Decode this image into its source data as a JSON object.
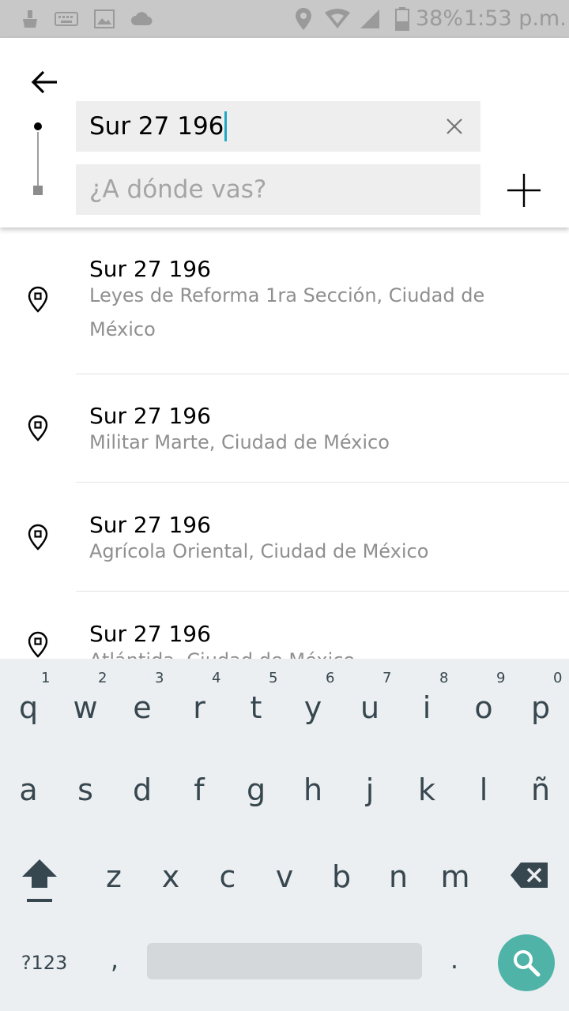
{
  "status_bar": {
    "battery": "38%",
    "time": "1:53 p.m."
  },
  "search": {
    "origin_value": "Sur 27 196",
    "destination_placeholder": "¿A dónde vas?"
  },
  "results": [
    {
      "title": "Sur 27 196",
      "subtitle": "Leyes de Reforma 1ra Sección, Ciudad de México"
    },
    {
      "title": "Sur 27 196",
      "subtitle": "Militar Marte, Ciudad de México"
    },
    {
      "title": "Sur 27 196",
      "subtitle": "Agrícola Oriental, Ciudad de México"
    },
    {
      "title": "Sur 27 196",
      "subtitle": "Atlántida, Ciudad de México"
    }
  ],
  "keyboard": {
    "row1": [
      {
        "key": "q",
        "hint": "1"
      },
      {
        "key": "w",
        "hint": "2"
      },
      {
        "key": "e",
        "hint": "3"
      },
      {
        "key": "r",
        "hint": "4"
      },
      {
        "key": "t",
        "hint": "5"
      },
      {
        "key": "y",
        "hint": "6"
      },
      {
        "key": "u",
        "hint": "7"
      },
      {
        "key": "i",
        "hint": "8"
      },
      {
        "key": "o",
        "hint": "9"
      },
      {
        "key": "p",
        "hint": "0"
      }
    ],
    "row2": [
      "a",
      "s",
      "d",
      "f",
      "g",
      "h",
      "j",
      "k",
      "l",
      "ñ"
    ],
    "row3": [
      "z",
      "x",
      "c",
      "v",
      "b",
      "n",
      "m"
    ],
    "symbols_label": "?123",
    "comma": ",",
    "period": "."
  },
  "colors": {
    "accent_caret": "#1fa9c8",
    "search_fab": "#4fb3a7",
    "keyboard_bg": "#eceff1"
  }
}
